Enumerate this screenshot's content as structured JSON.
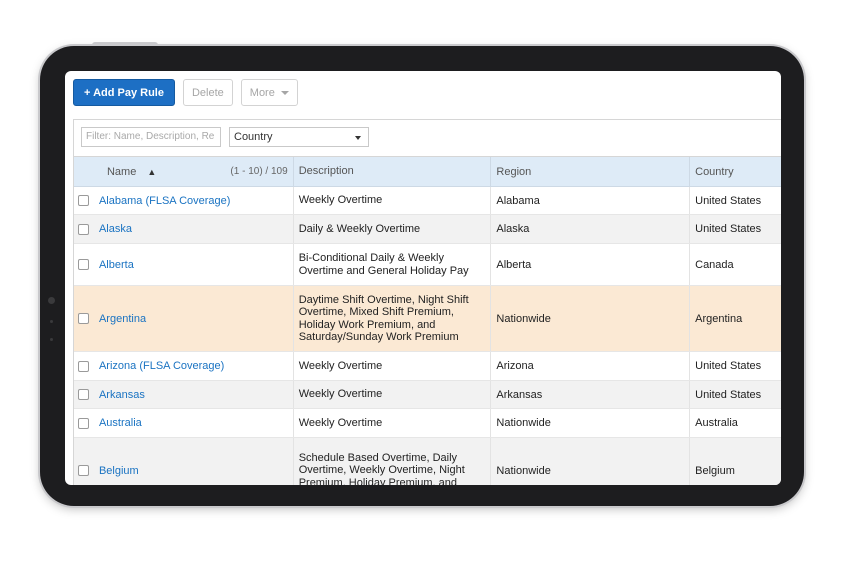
{
  "toolbar": {
    "add_label": "+ Add Pay Rule",
    "delete_label": "Delete",
    "more_label": "More"
  },
  "filter": {
    "search_placeholder": "Filter: Name, Description, Re",
    "country_value": "Country"
  },
  "table": {
    "columns": {
      "name": "Name",
      "sort_indicator": "▲",
      "pagination": "(1 - 10) / 109",
      "description": "Description",
      "region": "Region",
      "country": "Country"
    },
    "rows": [
      {
        "name": "Alabama (FLSA Coverage)",
        "description": "Weekly Overtime",
        "region": "Alabama",
        "country": "United States"
      },
      {
        "name": "Alaska",
        "description": "Daily & Weekly Overtime",
        "region": "Alaska",
        "country": "United States"
      },
      {
        "name": "Alberta",
        "description": "Bi-Conditional Daily & Weekly Overtime and General Holiday Pay",
        "region": "Alberta",
        "country": "Canada"
      },
      {
        "name": "Argentina",
        "description": "Daytime Shift Overtime, Night Shift Overtime, Mixed Shift Premium, Holiday Work Premium, and Saturday/Sunday Work Premium",
        "region": "Nationwide",
        "country": "Argentina"
      },
      {
        "name": "Arizona (FLSA Coverage)",
        "description": "Weekly Overtime",
        "region": "Arizona",
        "country": "United States"
      },
      {
        "name": "Arkansas",
        "description": "Weekly Overtime",
        "region": "Arkansas",
        "country": "United States"
      },
      {
        "name": "Australia",
        "description": "Weekly Overtime",
        "region": "Nationwide",
        "country": "Australia"
      },
      {
        "name": "Belgium",
        "description": "Schedule Based Overtime, Daily Overtime, Weekly Overtime, Night Premium, Holiday Premium, and",
        "region": "Nationwide",
        "country": "Belgium"
      }
    ]
  },
  "colors": {
    "primary": "#1d6fc4",
    "header_bg": "#deebf7",
    "highlight_row": "#fbe9d4",
    "link": "#1a73c2"
  }
}
